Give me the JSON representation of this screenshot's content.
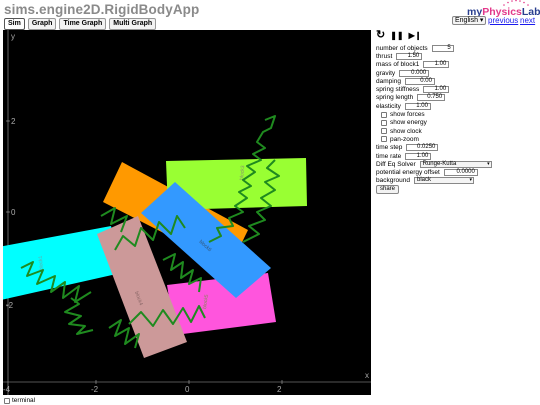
{
  "app": {
    "title": "sims.engine2D.RigidBodyApp"
  },
  "logo": {
    "part1": "my",
    "part2": "Physics",
    "part3": "Lab.com"
  },
  "language": "English",
  "links": {
    "previous": "previous",
    "next": "next"
  },
  "tabs": [
    "Sim",
    "Graph",
    "Time Graph",
    "Multi Graph"
  ],
  "sim": {
    "background_color": "#000000",
    "axis_labels": {
      "x": "x",
      "y": "y"
    },
    "x_ticks": [
      "-4",
      "-2",
      "0",
      "2"
    ],
    "y_ticks": [
      "2",
      "0",
      "-2"
    ],
    "blocks": [
      {
        "label": "block1",
        "color": "#00ffff"
      },
      {
        "label": "block2",
        "color": "#ff9900"
      },
      {
        "label": "block3",
        "color": "#99ff33"
      },
      {
        "label": "block4",
        "color": "#cc9999"
      },
      {
        "label": "block5",
        "color": "#ff55dd"
      },
      {
        "label": "block6",
        "color": "#3399ff"
      }
    ],
    "spring_color": "#1f8a1f"
  },
  "terminal_label": "terminal",
  "controls": {
    "restart": "↻",
    "pause": "❚❚",
    "step": "▶❙"
  },
  "params": {
    "number_of_objects": {
      "label": "number of objects",
      "value": "5"
    },
    "thrust": {
      "label": "thrust",
      "value": "1.50"
    },
    "mass_of_block1": {
      "label": "mass of block1",
      "value": "1.00"
    },
    "gravity": {
      "label": "gravity",
      "value": "0.000"
    },
    "damping": {
      "label": "damping",
      "value": "0.00"
    },
    "spring_stiffness": {
      "label": "spring stiffness",
      "value": "1.00"
    },
    "spring_length": {
      "label": "spring length",
      "value": "0.750"
    },
    "elasticity": {
      "label": "elasticity",
      "value": "1.00"
    }
  },
  "checkboxes": {
    "show_forces": "show forces",
    "show_energy": "show energy",
    "show_clock": "show clock",
    "pan_zoom": "pan-zoom"
  },
  "time_step": {
    "label": "time step",
    "value": "0.0250"
  },
  "time_rate": {
    "label": "time rate",
    "value": "1.00"
  },
  "diff_eq_solver": {
    "label": "Diff Eq Solver",
    "value": "Runge-Kutta"
  },
  "potential_energy_offset": {
    "label": "potential energy offset",
    "value": "0.0000"
  },
  "background": {
    "label": "background",
    "value": "black"
  },
  "share_label": "share"
}
